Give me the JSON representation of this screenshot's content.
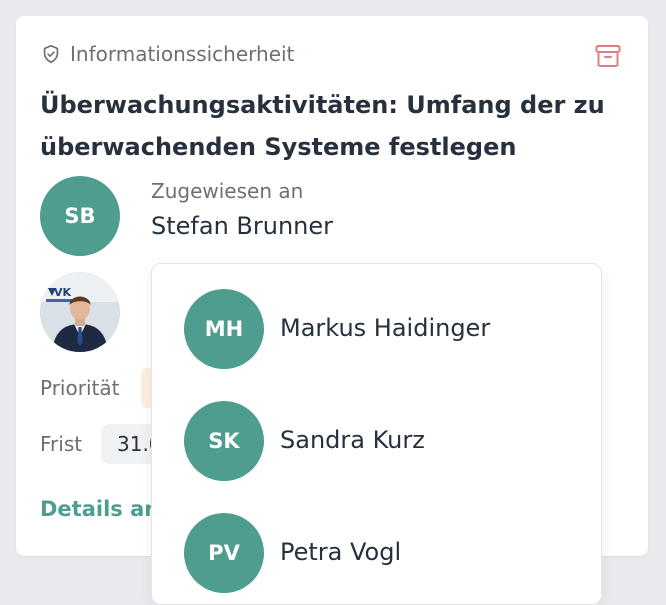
{
  "task": {
    "category": "Informationssicherheit",
    "category_icon": "shield-check-icon",
    "title": "Überwachungsaktivitäten: Umfang der zu überwachenden Systeme festlegen",
    "archive_icon": "archive-icon",
    "assignee": {
      "label": "Zugewiesen an",
      "name": "Stefan Brunner",
      "initials": "SB"
    },
    "priority_label": "Priorität",
    "deadline_label": "Frist",
    "deadline_value": "31.0",
    "details_link": "Details anz"
  },
  "dropdown": {
    "options": [
      {
        "initials": "MH",
        "name": "Markus Haidinger"
      },
      {
        "initials": "SK",
        "name": "Sandra Kurz"
      },
      {
        "initials": "PV",
        "name": "Petra Vogl"
      }
    ]
  },
  "colors": {
    "accent": "#4e9d8e",
    "archive_icon": "#e07f7f",
    "priority_badge": "#fbeedf",
    "text_primary": "#27313d",
    "text_secondary": "#6b6f76"
  }
}
